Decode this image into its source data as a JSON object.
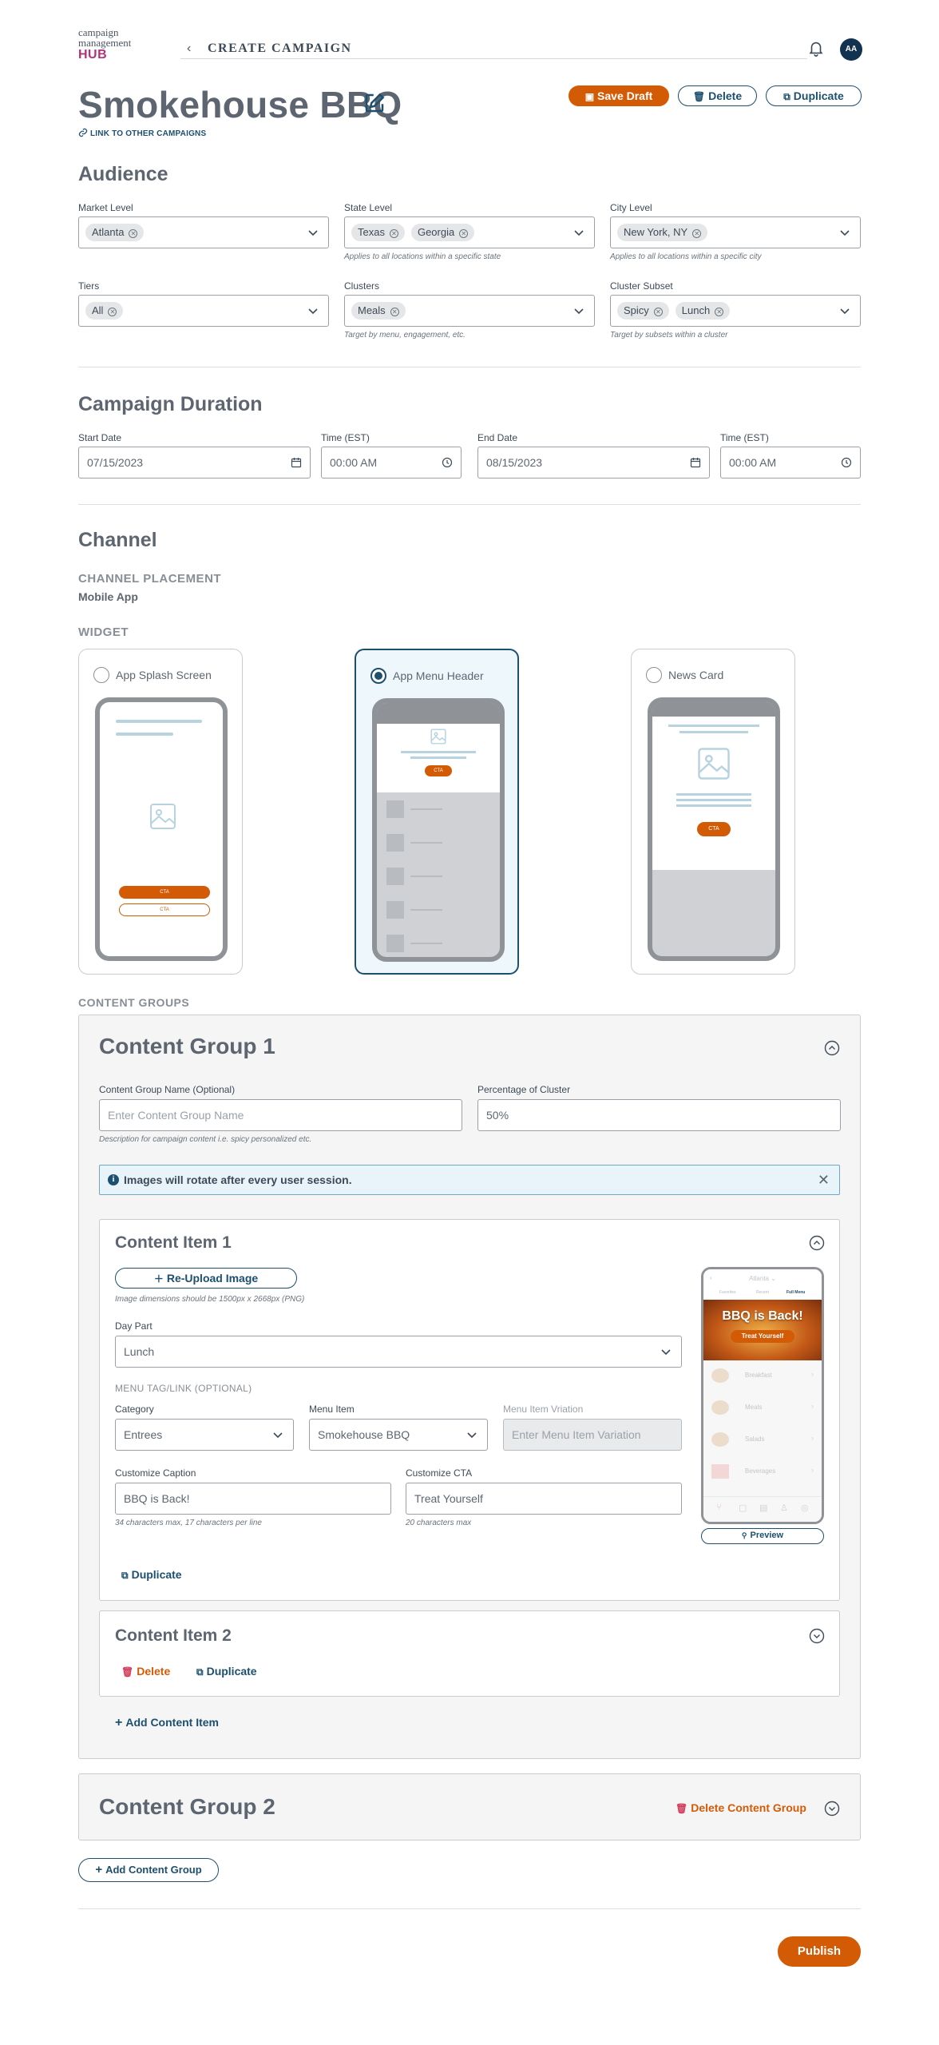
{
  "header": {
    "logo_line1": "campaign",
    "logo_line2": "management",
    "logo_line3": "HUB",
    "breadcrumb": "CREATE CAMPAIGN",
    "avatar_initials": "AA"
  },
  "campaign": {
    "title": "Smokehouse BBQ",
    "link_other": "LINK TO OTHER CAMPAIGNS"
  },
  "actions": {
    "save_draft": "Save Draft",
    "delete": "Delete",
    "duplicate": "Duplicate"
  },
  "audience": {
    "title": "Audience",
    "market": {
      "label": "Market Level",
      "chips": [
        "Atlanta"
      ]
    },
    "state": {
      "label": "State Level",
      "chips": [
        "Texas",
        "Georgia"
      ],
      "hint": "Applies to all locations within a specific state"
    },
    "city": {
      "label": "City Level",
      "chips": [
        "New York, NY"
      ],
      "hint": "Applies to all locations within a specific city"
    },
    "tiers": {
      "label": "Tiers",
      "chips": [
        "All"
      ]
    },
    "clusters": {
      "label": "Clusters",
      "chips": [
        "Meals"
      ],
      "hint": "Target by menu, engagement, etc."
    },
    "subset": {
      "label": "Cluster Subset",
      "chips": [
        "Spicy",
        "Lunch"
      ],
      "hint": "Target by subsets within a cluster"
    }
  },
  "duration": {
    "title": "Campaign Duration",
    "start_date_label": "Start Date",
    "start_date": "07/15/2023",
    "start_time_label": "Time (EST)",
    "start_time": "00:00 AM",
    "end_date_label": "End Date",
    "end_date": "08/15/2023",
    "end_time_label": "Time (EST)",
    "end_time": "00:00 AM"
  },
  "channel": {
    "title": "Channel",
    "placement_label": "CHANNEL PLACEMENT",
    "placement_value": "Mobile App",
    "widget_label": "WIDGET",
    "widgets": [
      {
        "label": "App Splash Screen",
        "selected": false,
        "cta": "CTA",
        "cta2": "CTA"
      },
      {
        "label": "App Menu Header",
        "selected": true,
        "cta": "CTA"
      },
      {
        "label": "News Card",
        "selected": false,
        "cta": "CTA"
      }
    ]
  },
  "content_groups": {
    "label": "CONTENT GROUPS",
    "group1": {
      "title": "Content Group 1",
      "name_label": "Content Group Name (Optional)",
      "name_placeholder": "Enter Content Group Name",
      "name_hint": "Description for campaign content i.e. spicy personalized etc.",
      "pct_label": "Percentage of Cluster",
      "pct_value": "50%",
      "info_text": "Images will rotate after every user session.",
      "item1": {
        "title": "Content Item 1",
        "reupload": "Re-Upload Image",
        "dims_hint": "Image dimensions should be 1500px x 2668px (PNG)",
        "daypart_label": "Day Part",
        "daypart_value": "Lunch",
        "menu_tag_label": "MENU TAG/LINK (OPTIONAL)",
        "category_label": "Category",
        "category_value": "Entrees",
        "menu_item_label": "Menu Item",
        "menu_item_value": "Smokehouse BBQ",
        "variation_label": "Menu Item Vriation",
        "variation_placeholder": "Enter Menu Item Variation",
        "caption_label": "Customize Caption",
        "caption_value": "BBQ is Back!",
        "caption_hint": "34 characters max, 17 characters per line",
        "cta_label": "Customize CTA",
        "cta_value": "Treat Yourself",
        "cta_hint": "20 characters max",
        "duplicate": "Duplicate",
        "preview": "Preview",
        "preview_phone": {
          "location": "Atlanta",
          "tabs": [
            "Favorites",
            "Recent",
            "Full Menu"
          ],
          "hero_caption": "BBQ is Back!",
          "hero_cta": "Treat Yourself",
          "menu": [
            "Breakfast",
            "Meals",
            "Salads",
            "Beverages"
          ]
        }
      },
      "item2": {
        "title": "Content Item 2",
        "delete": "Delete",
        "duplicate": "Duplicate"
      },
      "add_item": "Add Content Item"
    },
    "group2": {
      "title": "Content Group 2",
      "delete": "Delete Content Group"
    },
    "add_group": "Add Content Group"
  },
  "publish": "Publish",
  "colors": {
    "accent_orange": "#d35b06",
    "navy": "#1d4f6e",
    "hub_magenta": "#b0337a"
  }
}
